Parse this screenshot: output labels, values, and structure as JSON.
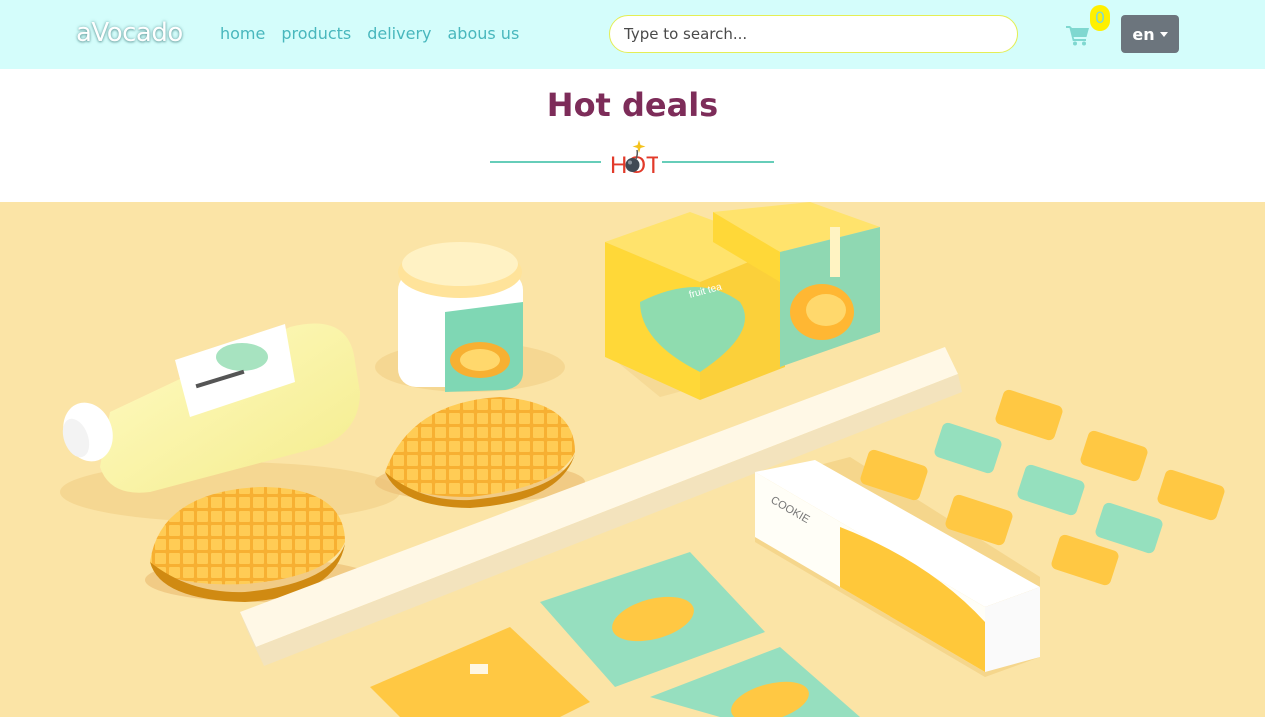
{
  "navbar": {
    "brand": "aVocado",
    "links": [
      "home",
      "products",
      "delivery",
      "abous us"
    ],
    "search_placeholder": "Type to search...",
    "cart_icon": "shopping-cart-icon",
    "cart_count": "0",
    "language": "en"
  },
  "section": {
    "title": "Hot deals",
    "badge_text": "HOT"
  },
  "hero": {
    "fruit_tea_label": "fruit tea",
    "cookie_label": "COOKIE"
  },
  "colors": {
    "navbar_bg": "#d4fdfb",
    "nav_link": "#48b7bd",
    "title": "#7d2c59",
    "divider": "#66cdb9",
    "hot_text": "#e23a2a",
    "cart_badge": "#fff000",
    "lang_button": "#6c757d",
    "hero_bg": "#fbe4a6"
  }
}
